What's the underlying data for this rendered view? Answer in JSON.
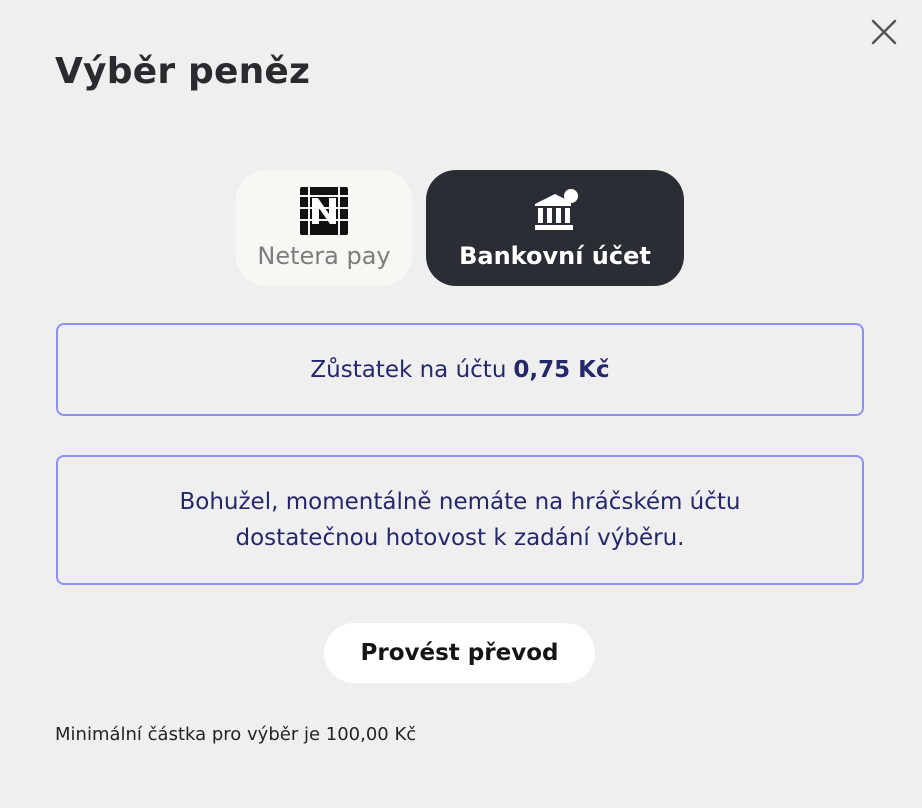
{
  "modal": {
    "title": "Výběr peněz",
    "close_icon": "close-icon"
  },
  "payment_methods": [
    {
      "label": "Netera pay",
      "icon": "netera-pay-logo-icon",
      "selected": false
    },
    {
      "label": "Bankovní účet",
      "icon": "bank-icon",
      "selected": true
    }
  ],
  "balance": {
    "label": "Zůstatek na účtu",
    "value": "0,75 Kč"
  },
  "warning": {
    "message": "Bohužel, momentálně nemáte na hráčském účtu dostatečnou hotovost k zadání výběru."
  },
  "actions": {
    "transfer_label": "Provést převod"
  },
  "footer": {
    "minimum_amount_note": "Minimální částka pro výběr je 100,00 Kč"
  },
  "colors": {
    "background": "#efefef",
    "title": "#2a2b2f",
    "selected_method_bg": "#2a2d33",
    "unselected_method_bg": "#f7f7f3",
    "box_border": "#8e90f4",
    "box_text": "#24286a",
    "button_bg": "#ffffff"
  }
}
